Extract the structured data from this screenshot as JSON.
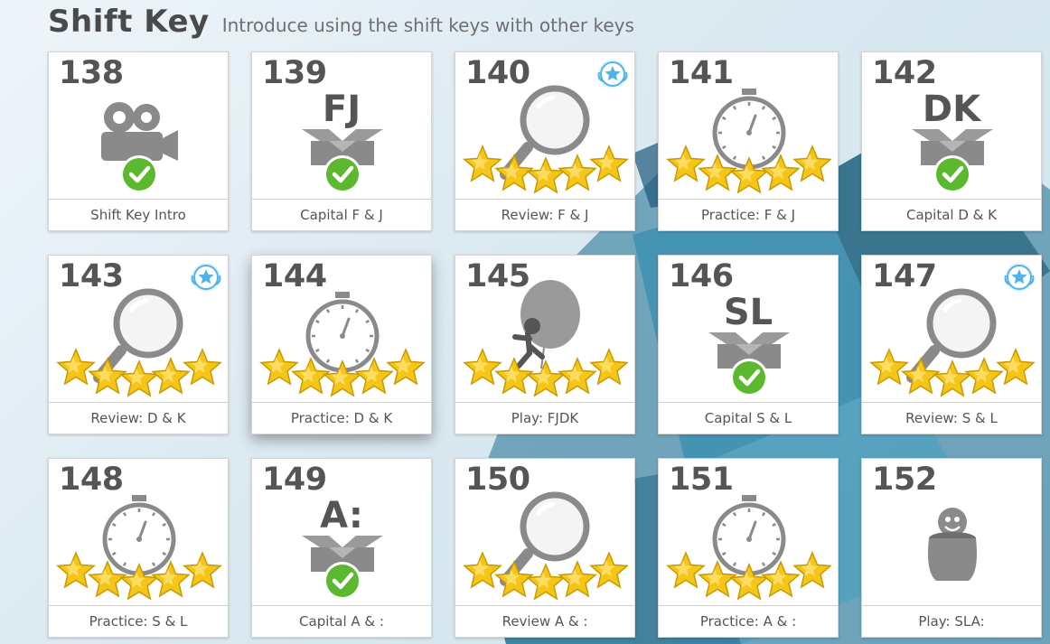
{
  "header": {
    "title": "Shift Key",
    "subtitle": "Introduce using the shift keys with other keys"
  },
  "colors": {
    "star": "#f5c518",
    "check": "#5cb82e",
    "icon_gray": "#8a8a8a",
    "badge": "#4fb3e8"
  },
  "lessons": [
    {
      "number": "138",
      "caption": "Shift Key Intro",
      "icon": "video-camera-icon",
      "completed": true,
      "stars": 0,
      "badge": false
    },
    {
      "number": "139",
      "caption": "Capital F & J",
      "icon": "open-box-icon",
      "key_label": "FJ",
      "completed": true,
      "stars": 0,
      "badge": false
    },
    {
      "number": "140",
      "caption": "Review: F & J",
      "icon": "magnifier-icon",
      "completed": false,
      "stars": 5,
      "badge": true
    },
    {
      "number": "141",
      "caption": "Practice: F & J",
      "icon": "stopwatch-icon",
      "completed": false,
      "stars": 5,
      "badge": false
    },
    {
      "number": "142",
      "caption": "Capital D & K",
      "icon": "open-box-icon",
      "key_label": "DK",
      "completed": true,
      "stars": 0,
      "badge": false
    },
    {
      "number": "143",
      "caption": "Review: D & K",
      "icon": "magnifier-icon",
      "completed": false,
      "stars": 5,
      "badge": true
    },
    {
      "number": "144",
      "caption": "Practice: D & K",
      "icon": "stopwatch-icon",
      "completed": false,
      "stars": 5,
      "badge": false
    },
    {
      "number": "145",
      "caption": "Play: FJDK",
      "icon": "balloon-runner-icon",
      "completed": false,
      "stars": 5,
      "badge": false
    },
    {
      "number": "146",
      "caption": "Capital S & L",
      "icon": "open-box-icon",
      "key_label": "SL",
      "completed": true,
      "stars": 0,
      "badge": false
    },
    {
      "number": "147",
      "caption": "Review: S & L",
      "icon": "magnifier-icon",
      "completed": false,
      "stars": 5,
      "badge": true
    },
    {
      "number": "148",
      "caption": "Practice: S & L",
      "icon": "stopwatch-icon",
      "completed": false,
      "stars": 5,
      "badge": false
    },
    {
      "number": "149",
      "caption": "Capital A & :",
      "icon": "open-box-icon",
      "key_label": "A:",
      "completed": true,
      "stars": 0,
      "badge": false
    },
    {
      "number": "150",
      "caption": "Review A & :",
      "icon": "magnifier-icon",
      "completed": false,
      "stars": 5,
      "badge": false
    },
    {
      "number": "151",
      "caption": "Practice: A & :",
      "icon": "stopwatch-icon",
      "completed": false,
      "stars": 5,
      "badge": false
    },
    {
      "number": "152",
      "caption": "Play: SLA:",
      "icon": "pot-creature-icon",
      "completed": false,
      "stars": 0,
      "badge": false
    }
  ]
}
